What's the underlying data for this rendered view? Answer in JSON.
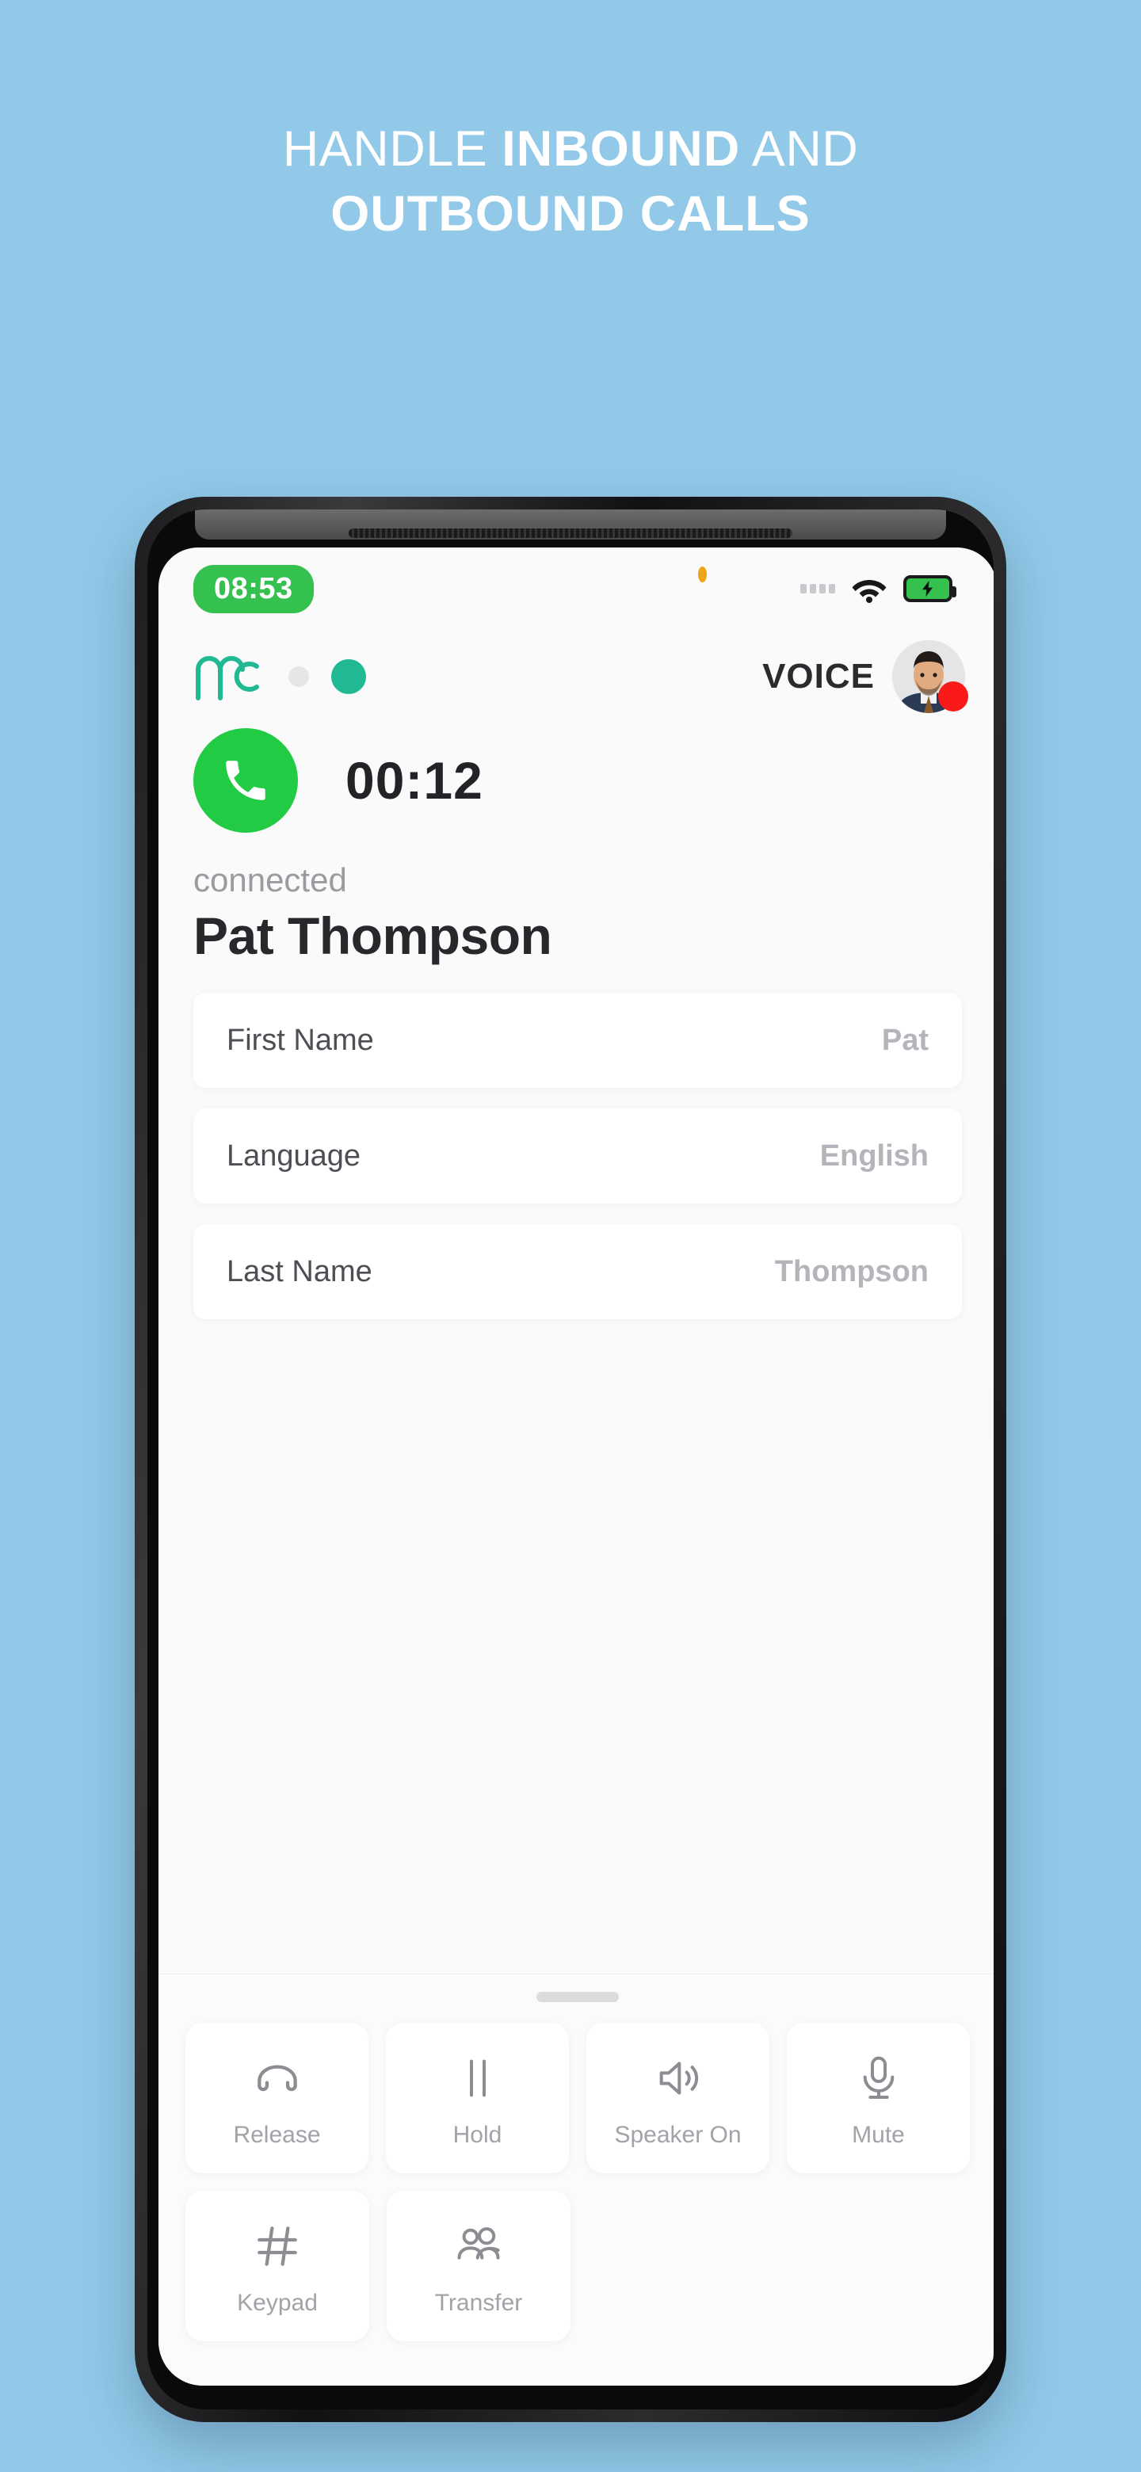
{
  "promo": {
    "line1_light": "HANDLE ",
    "line1_bold": "INBOUND",
    "line1_tail": " AND",
    "line2_bold": "OUTBOUND CALLS"
  },
  "colors": {
    "background": "#92c9e8",
    "brand_teal": "#21b894",
    "call_green": "#21cb44",
    "status_red": "#fa1a1a",
    "clock_green": "#34c14f"
  },
  "statusbar": {
    "time": "08:53",
    "signal_icon": "signal-dots-icon",
    "wifi_icon": "wifi-icon",
    "battery_icon": "battery-charging-icon",
    "camera_icon": "camera-dot-icon"
  },
  "app_header": {
    "logo_icon": "mc-logo-icon",
    "dot_inactive": "status-dot-inactive",
    "dot_active": "status-dot-active",
    "channel_label": "VOICE",
    "avatar_icon": "agent-avatar",
    "presence_icon": "presence-busy-dot"
  },
  "call": {
    "phone_icon": "phone-handset-icon",
    "timer": "00:12",
    "status": "connected",
    "contact_name": "Pat Thompson"
  },
  "fields": [
    {
      "label": "First Name",
      "value": "Pat"
    },
    {
      "label": "Language",
      "value": "English"
    },
    {
      "label": "Last Name",
      "value": "Thompson"
    }
  ],
  "controls": [
    {
      "label": "Release",
      "icon": "hangup-icon"
    },
    {
      "label": "Hold",
      "icon": "pause-icon"
    },
    {
      "label": "Speaker On",
      "icon": "speaker-icon"
    },
    {
      "label": "Mute",
      "icon": "microphone-icon"
    },
    {
      "label": "Keypad",
      "icon": "hash-keypad-icon"
    },
    {
      "label": "Transfer",
      "icon": "people-transfer-icon"
    }
  ]
}
